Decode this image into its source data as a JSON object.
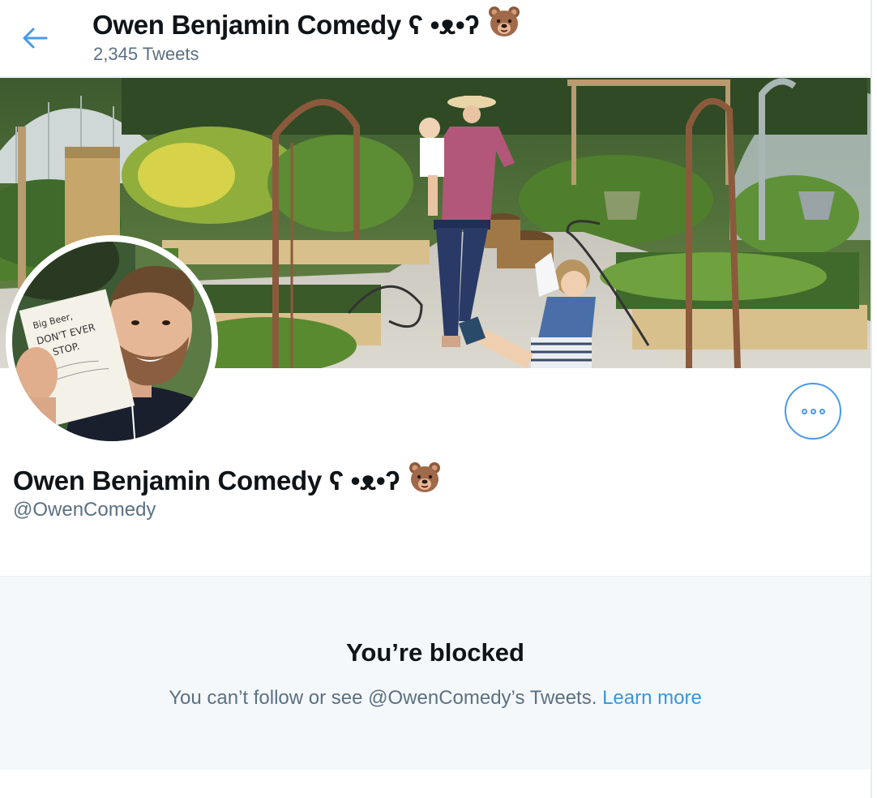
{
  "header": {
    "title": "Owen Benjamin Comedy ʕ •ᴥ•ʔ",
    "tweet_count": "2,345 Tweets"
  },
  "profile": {
    "name": "Owen Benjamin Comedy ʕ •ᴥ•ʔ",
    "handle": "@OwenComedy",
    "avatar_note_lines": [
      "Big Beer,",
      "DON'T EVER",
      "STOP."
    ]
  },
  "blocked": {
    "title": "You’re blocked",
    "message": "You can’t follow or see @OwenComedy’s Tweets.",
    "link": "Learn more"
  },
  "icons": {
    "back": "arrow-left-icon",
    "more": "more-horizontal-icon",
    "emoji": "bear-face-icon"
  },
  "colors": {
    "accent": "#4a99e9",
    "link": "#3b94d9",
    "muted_text": "#5b7083",
    "blocked_bg": "#f5f8fa"
  }
}
